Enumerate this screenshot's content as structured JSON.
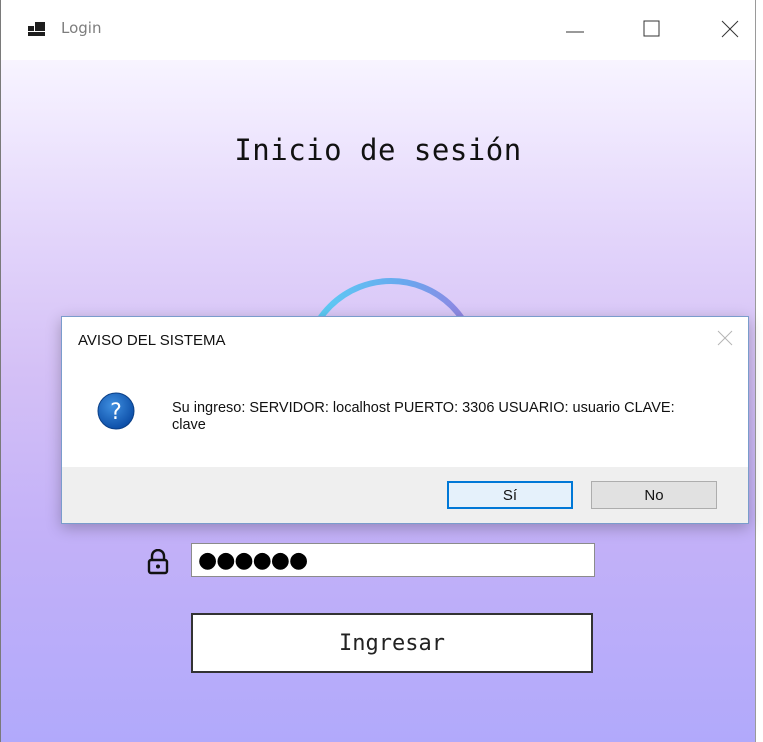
{
  "window": {
    "title": "Login",
    "app_icon": "window-app-icon"
  },
  "form": {
    "heading": "Inicio de sesión",
    "password_value": "●●●●●●",
    "submit_label": "Ingresar"
  },
  "dialog": {
    "title": "AVISO DEL SISTEMA",
    "icon": "question-icon",
    "message": "Su ingreso: SERVIDOR: localhost PUERTO: 3306 USUARIO: usuario CLAVE: clave",
    "yes_label": "Sí",
    "no_label": "No"
  },
  "colors": {
    "accent": "#0078d7",
    "question_icon": "#1565c0",
    "gradient_top": "#ffffff",
    "gradient_bottom": "#b1a9fb",
    "logo_ring": "#4fc3f7"
  }
}
